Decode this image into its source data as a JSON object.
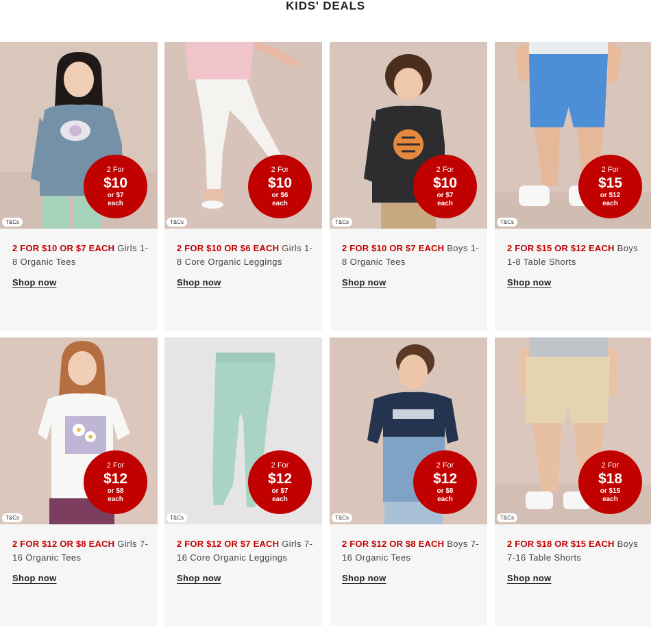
{
  "page": {
    "title": "KIDS' DEALS"
  },
  "colors": {
    "deal_red": "#c10000",
    "card_bg": "#f6f6f6"
  },
  "cards": [
    {
      "deal": "2 FOR $10 OR $7 EACH",
      "name": "Girls 1-8 Organic Tees",
      "cta": "Shop now",
      "tcs": "T&Cs",
      "roundel": {
        "line1": "2 For",
        "price": "$10",
        "or": "or $7",
        "each": "each"
      }
    },
    {
      "deal": "2 FOR $10 OR $6 EACH",
      "name": "Girls 1-8 Core Organic Leggings",
      "cta": "Shop now",
      "tcs": "T&Cs",
      "roundel": {
        "line1": "2 For",
        "price": "$10",
        "or": "or $6",
        "each": "each"
      }
    },
    {
      "deal": "2 FOR $10 OR $7 EACH",
      "name": "Boys 1-8 Organic Tees",
      "cta": "Shop now",
      "tcs": "T&Cs",
      "roundel": {
        "line1": "2 For",
        "price": "$10",
        "or": "or $7",
        "each": "each"
      }
    },
    {
      "deal": "2 FOR $15 OR $12 EACH",
      "name": "Boys 1-8 Table Shorts",
      "cta": "Shop now",
      "tcs": "T&Cs",
      "roundel": {
        "line1": "2 For",
        "price": "$15",
        "or": "or $12",
        "each": "each"
      }
    },
    {
      "deal": "2 FOR $12 OR $8 EACH",
      "name": "Girls 7-16 Organic Tees",
      "cta": "Shop now",
      "tcs": "T&Cs",
      "roundel": {
        "line1": "2 For",
        "price": "$12",
        "or": "or $8",
        "each": "each"
      }
    },
    {
      "deal": "2 FOR $12 OR $7 EACH",
      "name": "Girls 7-16 Core Organic Leggings",
      "cta": "Shop now",
      "tcs": "T&Cs",
      "roundel": {
        "line1": "2 For",
        "price": "$12",
        "or": "or $7",
        "each": "each"
      }
    },
    {
      "deal": "2 FOR $12 OR $8 EACH",
      "name": "Boys 7-16 Organic Tees",
      "cta": "Shop now",
      "tcs": "T&Cs",
      "roundel": {
        "line1": "2 For",
        "price": "$12",
        "or": "or $8",
        "each": "each"
      }
    },
    {
      "deal": "2 FOR $18 OR $15 EACH",
      "name": "Boys 7-16 Table Shorts",
      "cta": "Shop now",
      "tcs": "T&Cs",
      "roundel": {
        "line1": "2 For",
        "price": "$18",
        "or": "or $15",
        "each": "each"
      }
    }
  ]
}
